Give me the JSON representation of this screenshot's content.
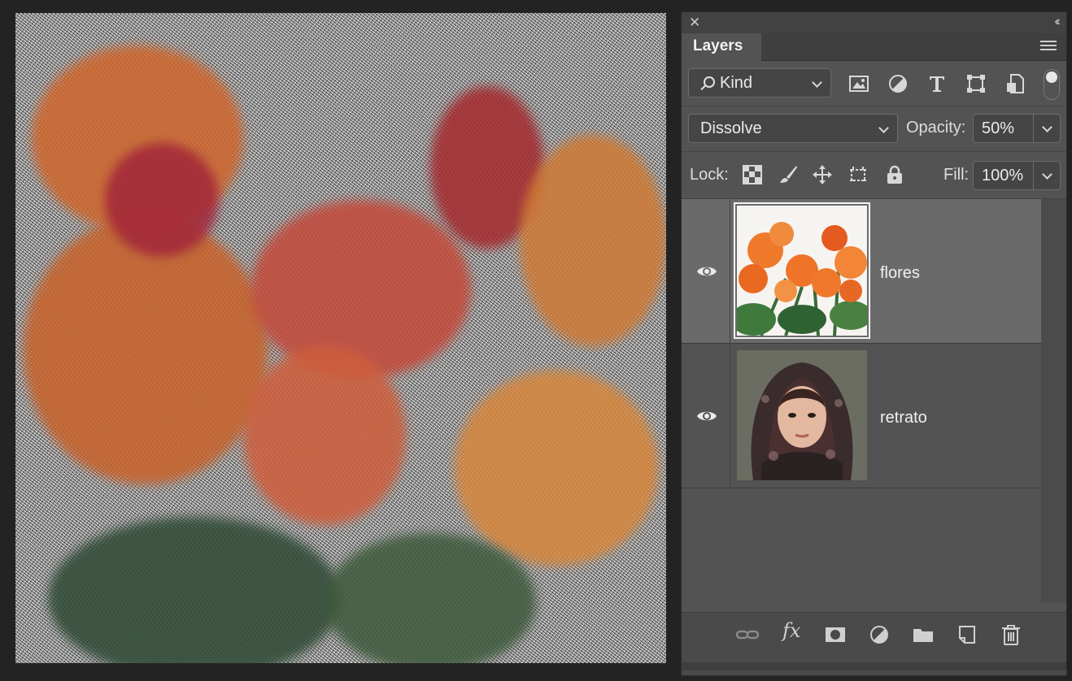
{
  "panel": {
    "close_glyph": "✕",
    "collapse_glyph": "‹‹",
    "tab_label": "Layers",
    "menu_icon": "hamburger-menu-icon"
  },
  "filter": {
    "kind_label": "Kind",
    "icons": [
      "image-filter-icon",
      "adjustment-filter-icon",
      "type-filter-icon",
      "shape-filter-icon",
      "smart-object-filter-icon"
    ]
  },
  "blend": {
    "mode": "Dissolve",
    "opacity_label": "Opacity:",
    "opacity_value": "50%"
  },
  "lock": {
    "label": "Lock:",
    "icons": [
      "lock-transparent-pixels-icon",
      "lock-image-pixels-icon",
      "lock-position-icon",
      "lock-artboard-icon",
      "lock-all-icon"
    ],
    "fill_label": "Fill:",
    "fill_value": "100%"
  },
  "layers": [
    {
      "name": "flores",
      "selected": true,
      "visible": true
    },
    {
      "name": "retrato",
      "selected": false,
      "visible": true
    }
  ],
  "bottom_icons": [
    "link-layers-icon",
    "fx-icon",
    "layer-mask-icon",
    "adjustment-layer-icon",
    "new-group-icon",
    "new-layer-icon",
    "trash-icon"
  ],
  "fx_label": "fx",
  "colors": {
    "panel_bg": "#535353",
    "selected_row": "#6a6a6a",
    "app_bg": "#232323"
  }
}
